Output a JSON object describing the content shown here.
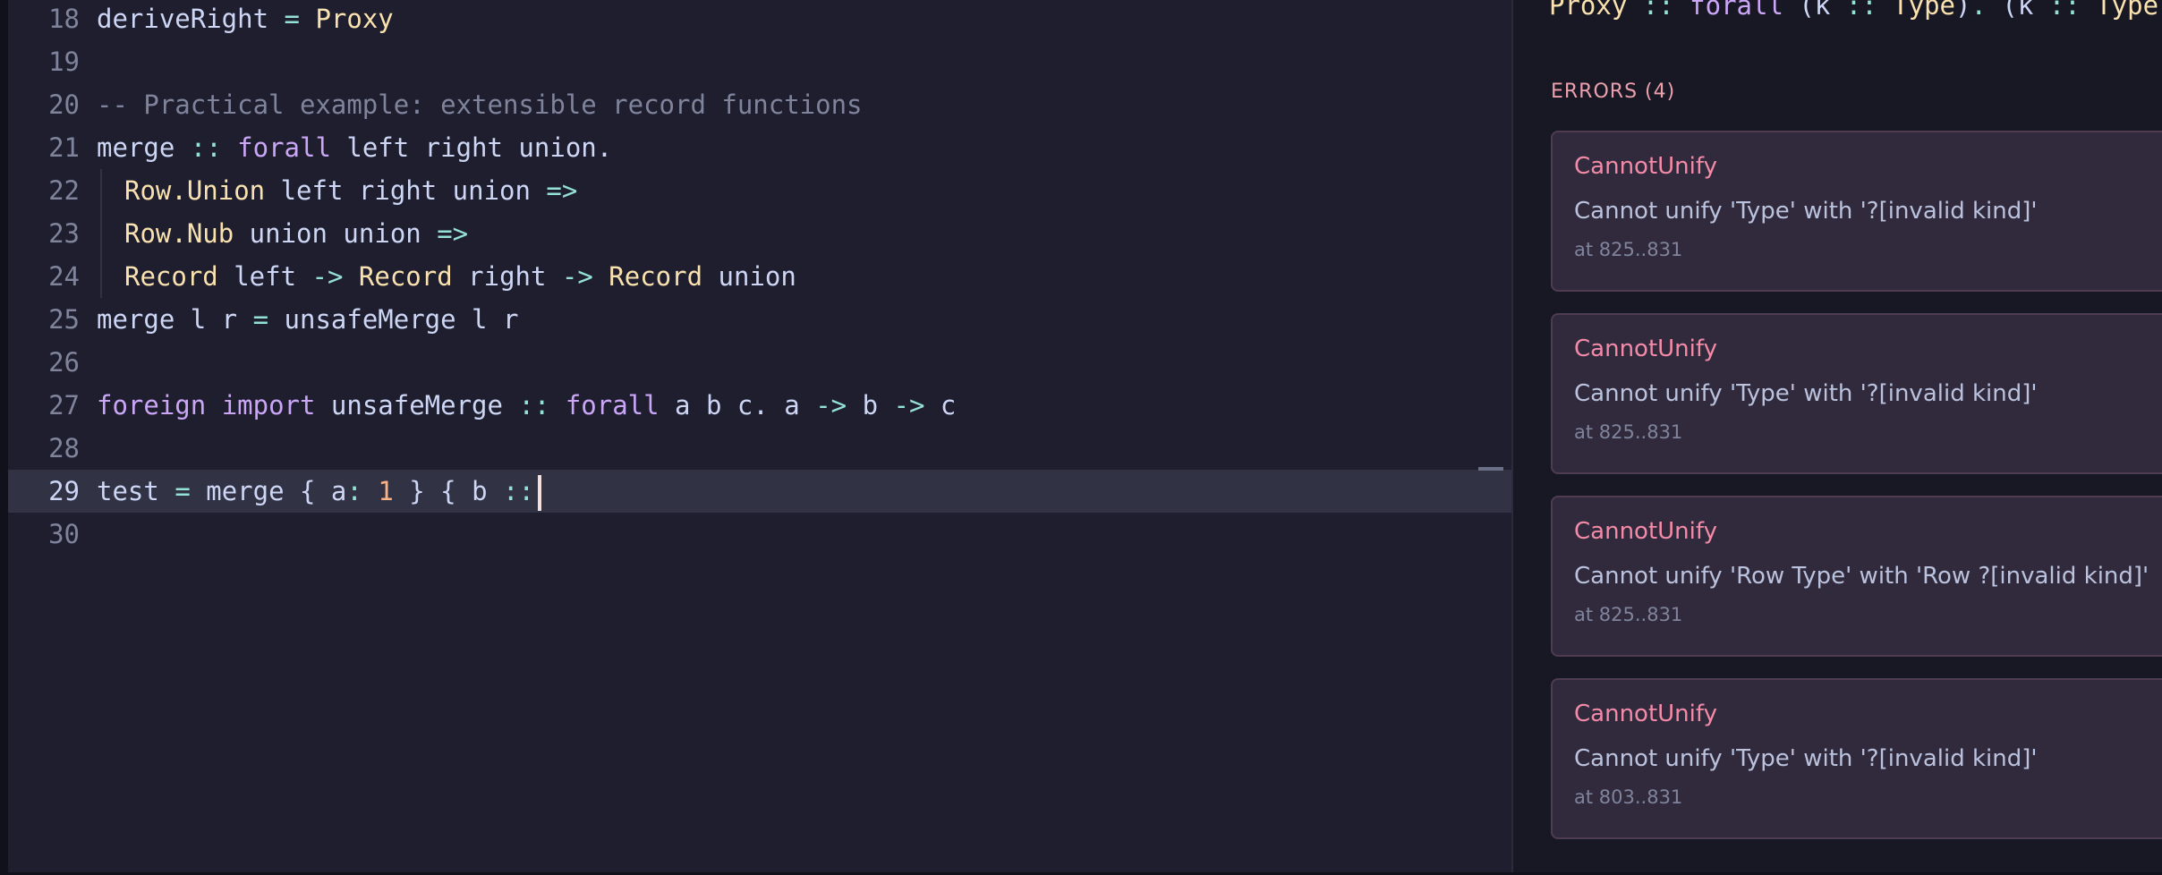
{
  "editor": {
    "lines": [
      {
        "num": "18",
        "tokens": [
          [
            "t-text",
            "deriveRight "
          ],
          [
            "t-op",
            "="
          ],
          [
            "t-text",
            " "
          ],
          [
            "t-type",
            "Proxy"
          ]
        ]
      },
      {
        "num": "19",
        "tokens": []
      },
      {
        "num": "20",
        "tokens": [
          [
            "t-comment",
            "-- Practical example: extensible record functions"
          ]
        ]
      },
      {
        "num": "21",
        "tokens": [
          [
            "t-text",
            "merge "
          ],
          [
            "t-op",
            "::"
          ],
          [
            "t-text",
            " "
          ],
          [
            "t-kw",
            "forall"
          ],
          [
            "t-text",
            " left right union."
          ]
        ]
      },
      {
        "num": "22",
        "indent": true,
        "tokens": [
          [
            "t-type",
            "Row.Union"
          ],
          [
            "t-text",
            " left right union "
          ],
          [
            "t-op",
            "=>"
          ]
        ]
      },
      {
        "num": "23",
        "indent": true,
        "tokens": [
          [
            "t-type",
            "Row.Nub"
          ],
          [
            "t-text",
            " union union "
          ],
          [
            "t-op",
            "=>"
          ]
        ]
      },
      {
        "num": "24",
        "indent": true,
        "tokens": [
          [
            "t-type",
            "Record"
          ],
          [
            "t-text",
            " left "
          ],
          [
            "t-op",
            "->"
          ],
          [
            "t-text",
            " "
          ],
          [
            "t-type",
            "Record"
          ],
          [
            "t-text",
            " right "
          ],
          [
            "t-op",
            "->"
          ],
          [
            "t-text",
            " "
          ],
          [
            "t-type",
            "Record"
          ],
          [
            "t-text",
            " union"
          ]
        ]
      },
      {
        "num": "25",
        "tokens": [
          [
            "t-text",
            "merge l r "
          ],
          [
            "t-op",
            "="
          ],
          [
            "t-text",
            " unsafeMerge l r"
          ]
        ]
      },
      {
        "num": "26",
        "tokens": []
      },
      {
        "num": "27",
        "tokens": [
          [
            "t-kw",
            "foreign"
          ],
          [
            "t-text",
            " "
          ],
          [
            "t-kw",
            "import"
          ],
          [
            "t-text",
            " unsafeMerge "
          ],
          [
            "t-op",
            "::"
          ],
          [
            "t-text",
            " "
          ],
          [
            "t-kw",
            "forall"
          ],
          [
            "t-text",
            " a b c. a "
          ],
          [
            "t-op",
            "->"
          ],
          [
            "t-text",
            " b "
          ],
          [
            "t-op",
            "->"
          ],
          [
            "t-text",
            " c"
          ]
        ]
      },
      {
        "num": "28",
        "tokens": []
      },
      {
        "num": "29",
        "current": true,
        "cursor": true,
        "tokens": [
          [
            "t-text",
            "test "
          ],
          [
            "t-op",
            "="
          ],
          [
            "t-text",
            " merge { a"
          ],
          [
            "t-op",
            ":"
          ],
          [
            "t-text",
            " "
          ],
          [
            "t-num",
            "1"
          ],
          [
            "t-text",
            " } { b "
          ],
          [
            "t-op",
            "::"
          ]
        ]
      },
      {
        "num": "30",
        "tokens": []
      }
    ]
  },
  "panel": {
    "type_signature_tokens": [
      [
        "t-type",
        "Proxy"
      ],
      [
        "t-text",
        " "
      ],
      [
        "t-op",
        "::"
      ],
      [
        "t-text",
        " "
      ],
      [
        "t-kw",
        "forall"
      ],
      [
        "t-text",
        " (k "
      ],
      [
        "t-op",
        "::"
      ],
      [
        "t-text",
        " "
      ],
      [
        "t-type",
        "Type"
      ],
      [
        "t-text",
        ")"
      ],
      [
        "t-op",
        "."
      ],
      [
        "t-text",
        " (k "
      ],
      [
        "t-op",
        "::"
      ],
      [
        "t-text",
        " "
      ],
      [
        "t-type",
        "Type"
      ],
      [
        "t-text",
        ") "
      ],
      [
        "t-op",
        "->"
      ]
    ],
    "errors_title": "ERRORS (4)",
    "errors": [
      {
        "name": "CannotUnify",
        "message": "Cannot unify 'Type' with '?[invalid kind]'",
        "location": "at 825..831"
      },
      {
        "name": "CannotUnify",
        "message": "Cannot unify 'Type' with '?[invalid kind]'",
        "location": "at 825..831"
      },
      {
        "name": "CannotUnify",
        "message": "Cannot unify 'Row Type' with 'Row ?[invalid kind]'",
        "location": "at 825..831"
      },
      {
        "name": "CannotUnify",
        "message": "Cannot unify 'Type' with '?[invalid kind]'",
        "location": "at 803..831"
      }
    ]
  },
  "colors": {
    "background": "#1e1e2e",
    "panel_background": "#181825",
    "current_line": "#313244",
    "keyword": "#cba6f7",
    "type": "#f9e2af",
    "operator": "#94e2d5",
    "number": "#fab387",
    "comment": "#7f849c",
    "error_accent": "#f38ba8",
    "error_card": "#312a3c"
  }
}
